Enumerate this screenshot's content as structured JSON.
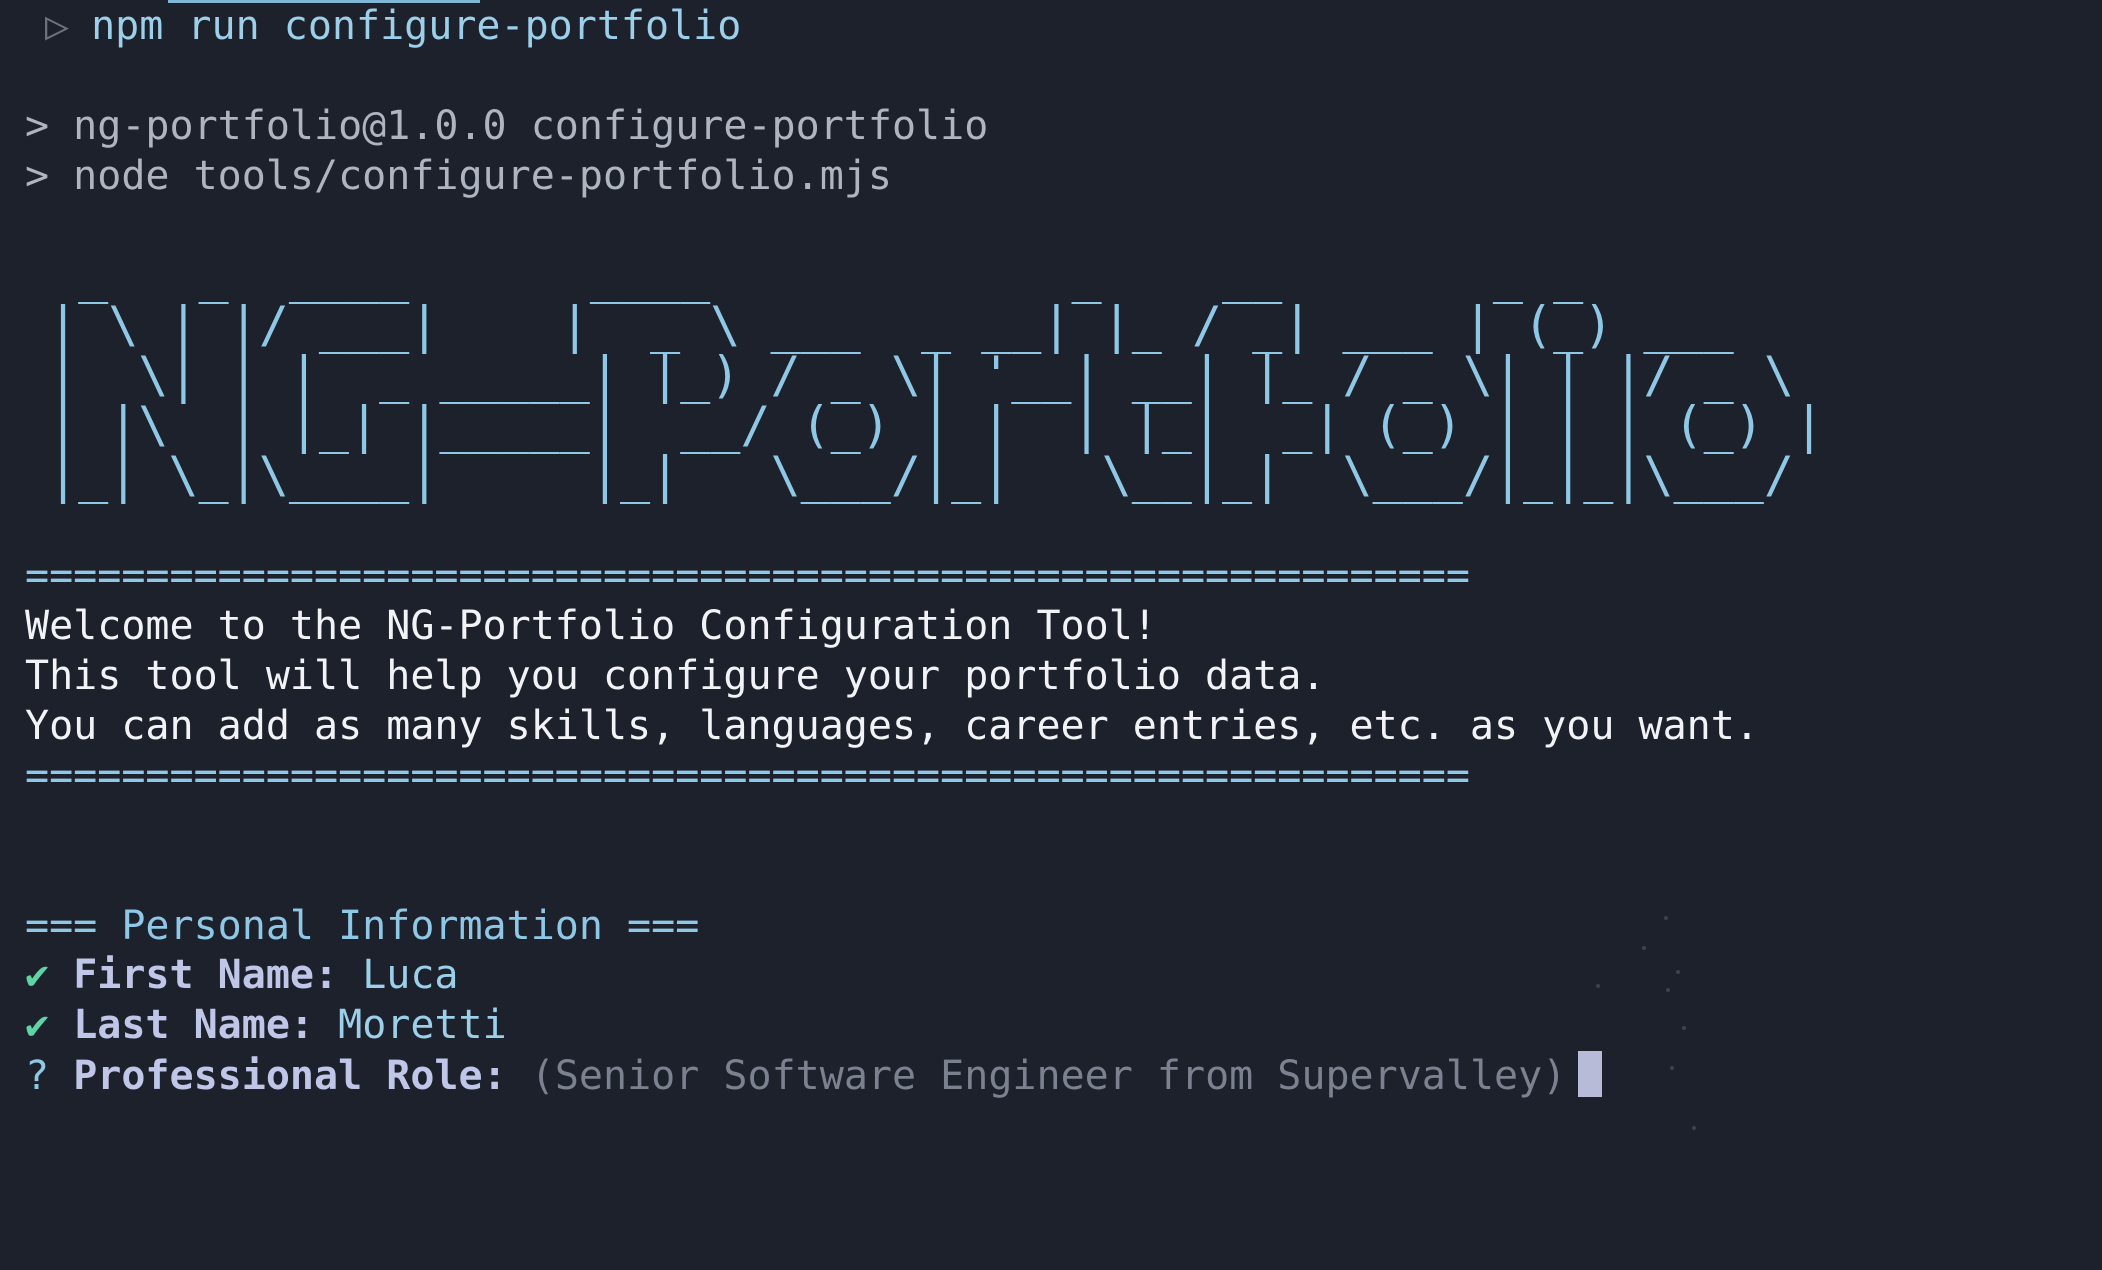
{
  "terminal": {
    "command": "npm run configure-portfolio",
    "npm_lines": [
      "> ng-portfolio@1.0.0 configure-portfolio",
      "> node tools/configure-portfolio.mjs"
    ],
    "ascii_banner": [
      " _   _  ____      ____            _    __       _ _       ",
      "| \\ | |/ ___|    |  _ \\ ___  _ __| |_ / _| ___ | (_) ___  ",
      "|  \\| | |  _ _____| |_) / _ \\| '__| __| |_ / _ \\| | |/ _ \\ ",
      "| |\\  | |_| |_____|  __/ (_) | |  | |_|  _| (_) | | | (_) |",
      "|_| \\_|\\____|     |_|   \\___/|_|   \\__|_|  \\___/|_|_|\\___/ "
    ],
    "rule": "============================================================",
    "welcome_lines": [
      "Welcome to the NG-Portfolio Configuration Tool!",
      "This tool will help you configure your portfolio data.",
      "You can add as many skills, languages, career entries, etc. as you want."
    ],
    "section_title": "=== Personal Information ===",
    "answers": [
      {
        "mark": "✔",
        "label": "First Name:",
        "value": "Luca"
      },
      {
        "mark": "✔",
        "label": "Last Name:",
        "value": "Moretti"
      }
    ],
    "question": {
      "mark": "?",
      "label": "Professional Role:",
      "hint": "(Senior Software Engineer from Supervalley)"
    }
  },
  "colors": {
    "background": "#1d212b",
    "accent": "#8fc8e6",
    "check": "#5fd3a4"
  }
}
